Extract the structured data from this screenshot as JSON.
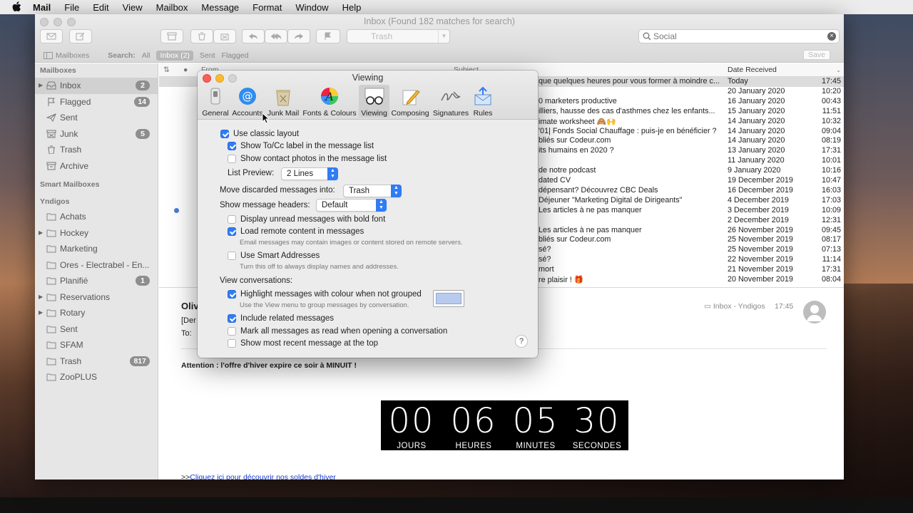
{
  "menubar": {
    "app": "Mail",
    "items": [
      "File",
      "Edit",
      "View",
      "Mailbox",
      "Message",
      "Format",
      "Window",
      "Help"
    ]
  },
  "window": {
    "title": "Inbox (Found 182 matches for search)",
    "move_to": "Trash",
    "search_value": "Social"
  },
  "favbar": {
    "mailboxes": "Mailboxes",
    "search_label": "Search:",
    "scopes": [
      "All",
      "Inbox (2)",
      "Sent",
      "Flagged"
    ],
    "save": "Save"
  },
  "sidebar": {
    "mailboxes_header": "Mailboxes",
    "mailboxes": [
      {
        "label": "Inbox",
        "badge": "2",
        "icon": "inbox-icon"
      },
      {
        "label": "Flagged",
        "badge": "14",
        "icon": "flag-icon"
      },
      {
        "label": "Sent",
        "badge": "",
        "icon": "paper-plane-icon"
      },
      {
        "label": "Junk",
        "badge": "5",
        "icon": "junk-bin-icon"
      },
      {
        "label": "Trash",
        "badge": "",
        "icon": "trash-icon"
      },
      {
        "label": "Archive",
        "badge": "",
        "icon": "archive-box-icon"
      }
    ],
    "smart_header": "Smart Mailboxes",
    "account_header": "Yndigos",
    "folders": [
      {
        "label": "Achats",
        "badge": ""
      },
      {
        "label": "Hockey",
        "badge": ""
      },
      {
        "label": "Marketing",
        "badge": ""
      },
      {
        "label": "Ores - Electrabel - En...",
        "badge": ""
      },
      {
        "label": "Planifié",
        "badge": "1"
      },
      {
        "label": "Reservations",
        "badge": ""
      },
      {
        "label": "Rotary",
        "badge": ""
      },
      {
        "label": "Sent",
        "badge": ""
      },
      {
        "label": "SFAM",
        "badge": ""
      },
      {
        "label": "Trash",
        "badge": "817"
      },
      {
        "label": "ZooPLUS",
        "badge": ""
      }
    ]
  },
  "list": {
    "col_from": "From",
    "col_subject": "Subject",
    "col_date": "Date Received",
    "rows": [
      {
        "subject": "que quelques heures pour vous former à moindre c...",
        "date": "Today",
        "time": "17:45"
      },
      {
        "subject": "",
        "date": "20 January 2020",
        "time": "10:20"
      },
      {
        "subject": "0 marketers productive",
        "date": "16 January 2020",
        "time": "00:43"
      },
      {
        "subject": "illiers, hausse des cas d'asthmes chez les enfants...",
        "date": "15 January 2020",
        "time": "11:51"
      },
      {
        "subject": "imate worksheet 🙈🙌",
        "date": "14 January 2020",
        "time": "10:32"
      },
      {
        "subject": "'01| Fonds Social Chauffage : puis-je en bénéficier ?",
        "date": "14 January 2020",
        "time": "09:04"
      },
      {
        "subject": "bliés sur Codeur.com",
        "date": "14 January 2020",
        "time": "08:19"
      },
      {
        "subject": "its humains en 2020 ?",
        "date": "13 January 2020",
        "time": "17:31"
      },
      {
        "subject": "",
        "date": "11 January 2020",
        "time": "10:01"
      },
      {
        "subject": "de notre podcast",
        "date": "9 January 2020",
        "time": "10:16"
      },
      {
        "subject": "dated CV",
        "date": "19 December 2019",
        "time": "10:47"
      },
      {
        "subject": "dépensant? Découvrez CBC Deals",
        "date": "16 December 2019",
        "time": "16:03"
      },
      {
        "subject": "Déjeuner \"Marketing Digital de Dirigeants\"",
        "date": "4 December 2019",
        "time": "17:03"
      },
      {
        "subject": "Les articles à ne pas manquer",
        "date": "3 December 2019",
        "time": "10:09"
      },
      {
        "subject": "",
        "date": "2 December 2019",
        "time": "12:31"
      },
      {
        "subject": "Les articles à ne pas manquer",
        "date": "26 November 2019",
        "time": "09:45"
      },
      {
        "subject": "bliés sur Codeur.com",
        "date": "25 November 2019",
        "time": "08:17"
      },
      {
        "subject": "sé?",
        "date": "25 November 2019",
        "time": "07:13"
      },
      {
        "subject": "sé?",
        "date": "22 November 2019",
        "time": "11:14"
      },
      {
        "subject": "mort",
        "date": "21 November 2019",
        "time": "17:31"
      },
      {
        "subject": "re plaisir ! 🎁",
        "date": "20 November 2019",
        "time": "08:04"
      }
    ]
  },
  "preview": {
    "from": "Oliv",
    "line2": "[Der",
    "to_label": "To:",
    "mailbox": "Inbox - Yndigos",
    "time": "17:45",
    "attention": "Attention : l'offre d'hiver expire ce soir à MINUIT !",
    "countdown": [
      {
        "value": "00",
        "label": "JOURS"
      },
      {
        "value": "06",
        "label": "HEURES"
      },
      {
        "value": "05",
        "label": "MINUTES"
      },
      {
        "value": "30",
        "label": "SECONDES"
      }
    ],
    "link_prefix": ">>",
    "link_text": "Cliquez ici pour découvrir nos soldes d'hiver"
  },
  "prefs": {
    "title": "Viewing",
    "tabs": [
      "General",
      "Accounts",
      "Junk Mail",
      "Fonts & Colours",
      "Viewing",
      "Composing",
      "Signatures",
      "Rules"
    ],
    "use_classic_layout": "Use classic layout",
    "show_tocc": "Show To/Cc label in the message list",
    "show_photos": "Show contact photos in the message list",
    "list_preview_label": "List Preview:",
    "list_preview_value": "2 Lines",
    "move_discarded_label": "Move discarded messages into:",
    "move_discarded_value": "Trash",
    "show_headers_label": "Show message headers:",
    "show_headers_value": "Default",
    "bold_unread": "Display unread messages with bold font",
    "load_remote": "Load remote content in messages",
    "load_remote_hint": "Email messages may contain images or content stored on remote servers.",
    "smart_addresses": "Use Smart Addresses",
    "smart_addresses_hint": "Turn this off to always display names and addresses.",
    "view_conversations": "View conversations:",
    "highlight": "Highlight messages with colour when not grouped",
    "highlight_hint": "Use the View menu to group messages by conversation.",
    "highlight_color": "#b8cbee",
    "include_related": "Include related messages",
    "mark_all_read": "Mark all messages as read when opening a conversation",
    "most_recent_top": "Show most recent message at the top",
    "help": "?"
  }
}
